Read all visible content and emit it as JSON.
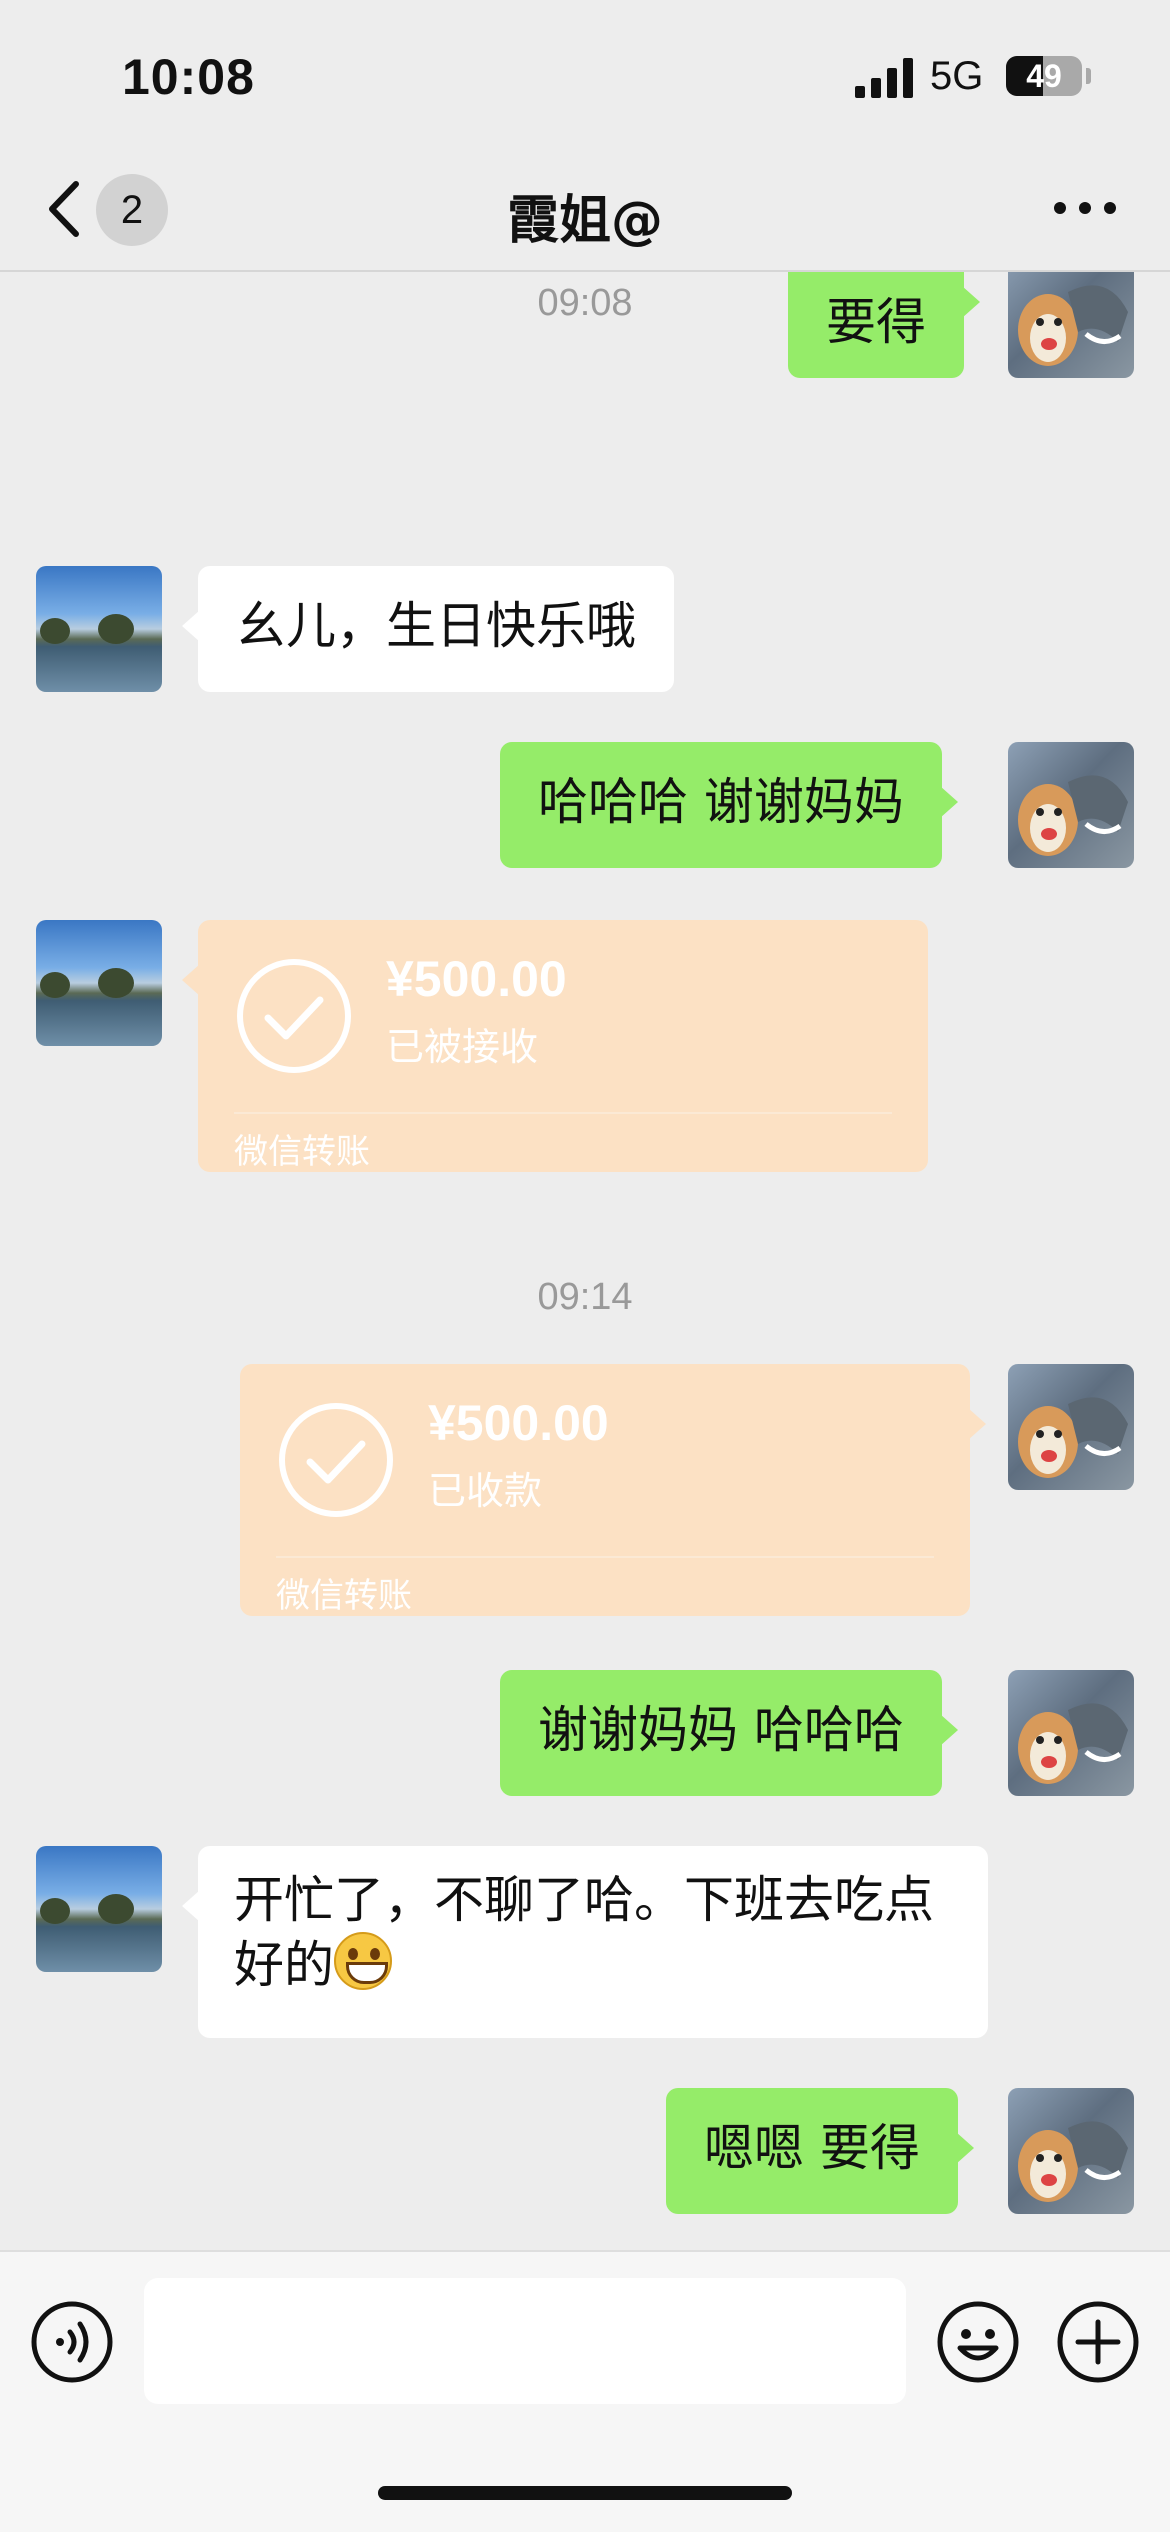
{
  "status_bar": {
    "time": "10:08",
    "network": "5G",
    "battery": "49",
    "battery_level": 0.49
  },
  "nav": {
    "unread_count": "2",
    "title": "霞姐@"
  },
  "messages": [
    {
      "type": "text",
      "side": "right",
      "text": "要得"
    },
    {
      "type": "timestamp",
      "text": "09:08"
    },
    {
      "type": "text",
      "side": "left",
      "text": "幺儿，生日快乐哦"
    },
    {
      "type": "text",
      "side": "right",
      "text": "哈哈哈 谢谢妈妈"
    },
    {
      "type": "transfer",
      "side": "left",
      "amount": "¥500.00",
      "status": "已被接收",
      "label": "微信转账"
    },
    {
      "type": "timestamp",
      "text": "09:14"
    },
    {
      "type": "transfer",
      "side": "right",
      "amount": "¥500.00",
      "status": "已收款",
      "label": "微信转账"
    },
    {
      "type": "text",
      "side": "right",
      "text": "谢谢妈妈 哈哈哈"
    },
    {
      "type": "text",
      "side": "left",
      "text": "开忙了，不聊了哈。下班去吃点好的",
      "emoji": "grinning-face"
    },
    {
      "type": "text",
      "side": "right",
      "text": "嗯嗯 要得"
    }
  ],
  "input_bar": {
    "text_value": "",
    "left_icon": "voice-icon",
    "right_icons": [
      "emoji-icon",
      "plus-icon"
    ]
  },
  "colors": {
    "background": "#ededed",
    "outgoing_bubble": "#95ec69",
    "incoming_bubble": "#ffffff",
    "transfer_card": "#fce1c4"
  }
}
